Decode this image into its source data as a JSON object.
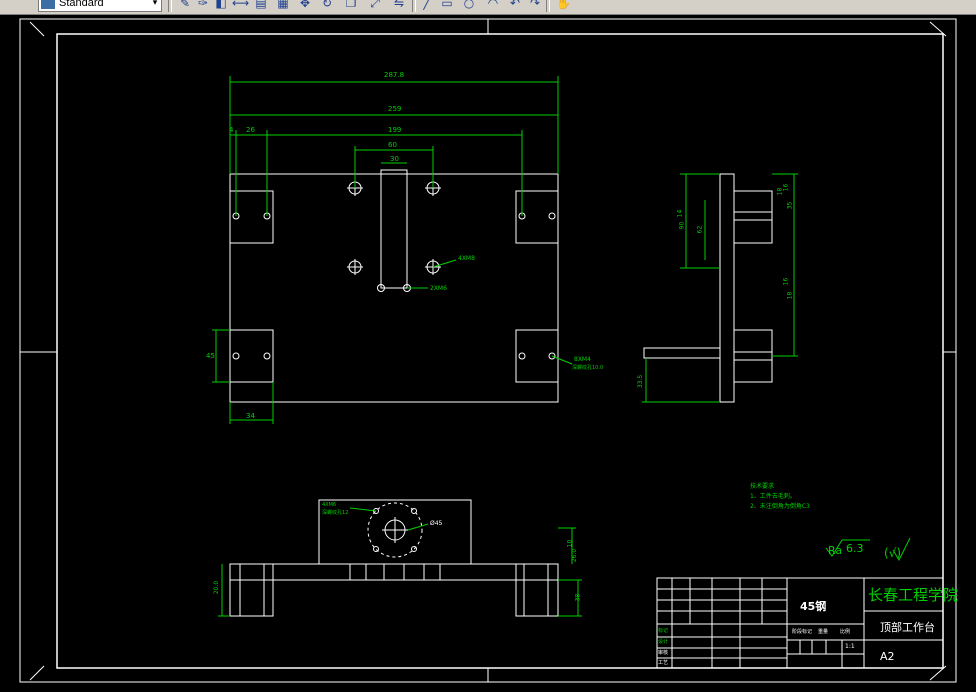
{
  "toolbar": {
    "style_combo": "Standard",
    "icons": [
      "draw-icon",
      "pen-icon",
      "dimension-icon",
      "text-icon",
      "grid-icon",
      "move-icon",
      "rotate-icon",
      "copy-icon",
      "scale-icon",
      "mirror-icon",
      "line-icon",
      "rect-icon",
      "circle-icon",
      "arc-icon",
      "undo-icon",
      "pan-icon"
    ]
  },
  "front_view": {
    "dims": {
      "overall": "287.8",
      "width_259": "259",
      "spacing_199": "199",
      "left_26": "26",
      "left_4": "4",
      "hole_60": "60",
      "hole_30": "30",
      "block_34": "34",
      "block_h_45": "45"
    },
    "callouts": {
      "holes_4x": "4XM8",
      "small_holes": "2XM6",
      "screws": "8XM4",
      "screws_sub": "深螺纹孔10.0"
    }
  },
  "side_view": {
    "dims": {
      "d_14": "14",
      "d_62": "62",
      "d_18": "18",
      "d_90": "90",
      "d_16_top": "16",
      "d_35": "35",
      "d_16_mid": "16",
      "d_18_b": "18",
      "d_337": "33.5"
    }
  },
  "bottom_view": {
    "callouts": {
      "holes": "4XM6",
      "holes_sub": "深螺纹孔12",
      "diameter": "Ø45"
    },
    "dims": {
      "h_10": "10",
      "h_26": "26.0",
      "h_20": "20.0",
      "h_38": "38"
    }
  },
  "tech_notes": {
    "title": "技术要求",
    "lines": [
      "1、工件去毛刺。",
      "2、未注倒角为倒角C3"
    ]
  },
  "roughness": {
    "symbol": "Ra",
    "value": "6.3",
    "general": "(√)"
  },
  "title_block": {
    "material": "45钢",
    "school": "长春工程学院",
    "part_name": "顶部工作台",
    "sheet_size": "A2",
    "scale": "1:1",
    "rows_left": [
      "标记",
      "设计",
      "审核",
      "工艺"
    ],
    "labels_mid": [
      "阶段标记",
      "重量",
      "比例"
    ]
  }
}
